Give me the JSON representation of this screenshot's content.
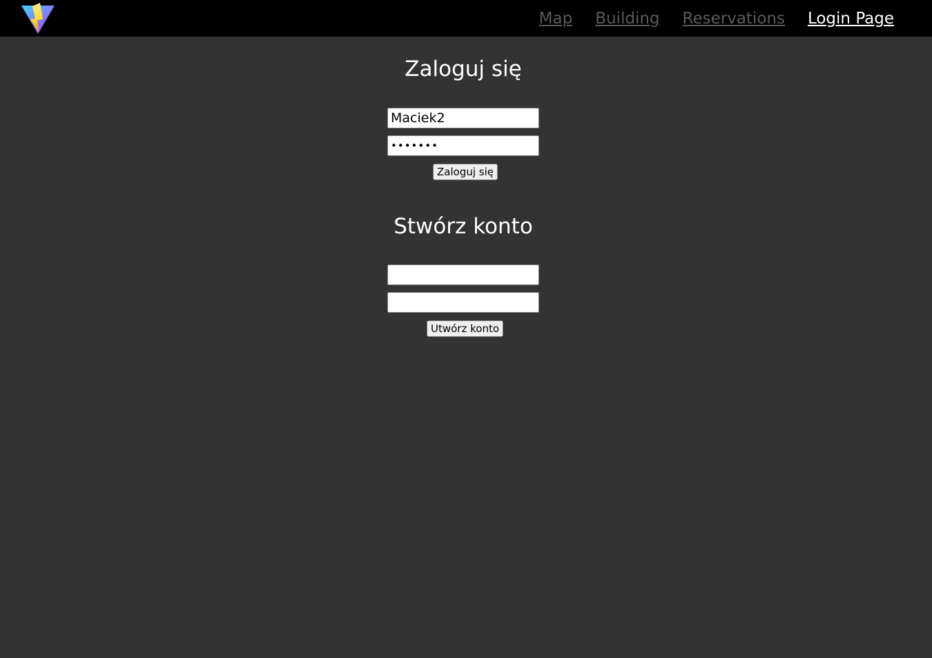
{
  "navbar": {
    "logo_icon": "vite-lightning-logo",
    "links": [
      {
        "label": "Map",
        "active": false
      },
      {
        "label": "Building",
        "active": false
      },
      {
        "label": "Reservations",
        "active": false
      },
      {
        "label": "Login Page",
        "active": true
      }
    ]
  },
  "login": {
    "title": "Zaloguj się",
    "username_value": "Maciek2",
    "password_value": "•••••••",
    "submit_label": "Zaloguj się"
  },
  "register": {
    "title": "Stwórz konto",
    "username_value": "",
    "password_value": "",
    "submit_label": "Utwórz konto"
  },
  "colors": {
    "background": "#333333",
    "navbar": "#000000",
    "nav_inactive": "#5a5a5a",
    "nav_active": "#ffffff"
  }
}
